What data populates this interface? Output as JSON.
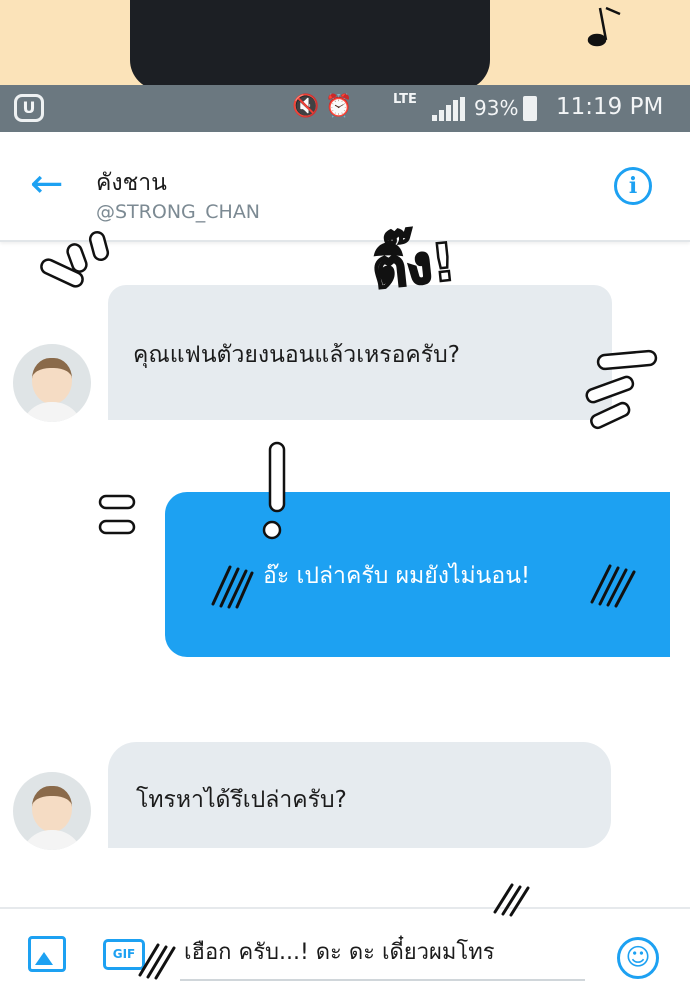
{
  "status_bar": {
    "network": "LTE",
    "battery": "93%",
    "time": "11:19 PM"
  },
  "conversation": {
    "name": "คังชาน",
    "handle": "@STRONG_CHAN"
  },
  "messages": [
    {
      "direction": "incoming",
      "text": "คุณแฟนตัวยงนอนแล้วเหรอครับ?"
    },
    {
      "direction": "outgoing",
      "text": "อ๊ะ เปล่าครับ ผมยังไม่นอน!"
    },
    {
      "direction": "incoming",
      "text": "โทรหาได้รึเปล่าครับ?"
    }
  ],
  "composer": {
    "gif_label": "GIF",
    "draft": "เฮือก ครับ...! ดะ ดะ เดี๋ยวผมโทร"
  },
  "sound_effect": "ติ๊ง!",
  "icons": {
    "back": "arrow-left-icon",
    "info": "info-icon",
    "image": "image-icon",
    "gif": "gif-icon",
    "emoji": "emoji-icon"
  },
  "colors": {
    "accent": "#1da1f2",
    "incoming_bubble": "#e6ebef",
    "status_bar": "#6b7880"
  }
}
